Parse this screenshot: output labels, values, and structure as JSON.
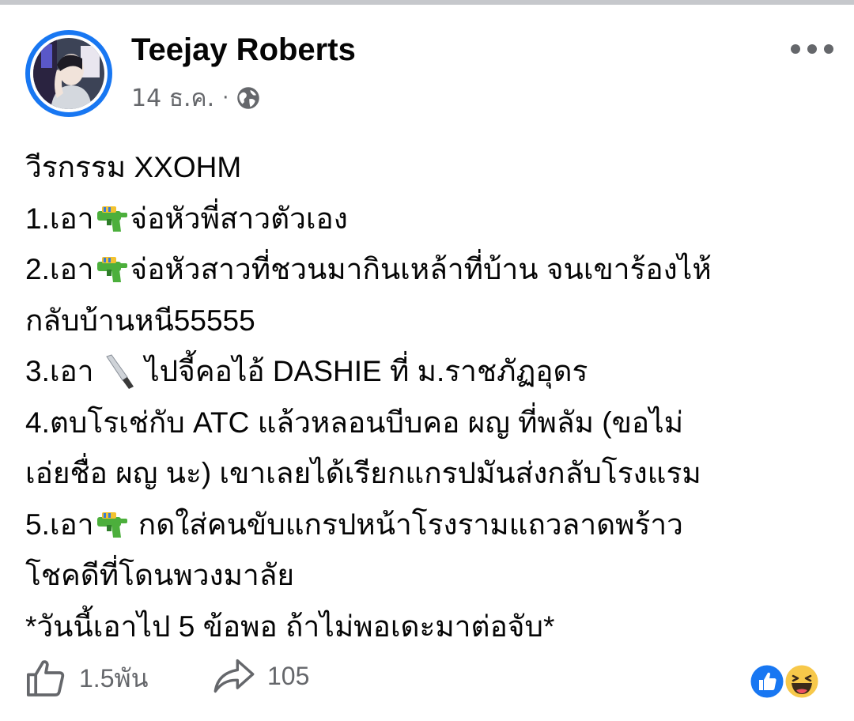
{
  "post": {
    "author": "Teejay Roberts",
    "date": "14 ธ.ค.",
    "separator": "·",
    "audience_icon": "globe-icon",
    "menu_icon": "more-horizontal-icon",
    "lines": [
      {
        "segments": [
          "วีรกรรม XXOHM"
        ]
      },
      {
        "segments": [
          "1.เอา",
          "จ่อหัวพี่สาวตัวเอง"
        ],
        "emoji": "water-pistol-emoji"
      },
      {
        "segments": [
          "2.เอา",
          "จ่อหัวสาวที่ชวนมากินเหล้าที่บ้าน จนเขาร้องไห้"
        ],
        "emoji": "water-pistol-emoji"
      },
      {
        "segments": [
          "กลับบ้านหนี55555"
        ]
      },
      {
        "segments": [
          "3.เอา ",
          " ไปจี้คอไอ้ DASHIE ที่ ม.ราชภัฏอุดร"
        ],
        "emoji": "knife-emoji"
      },
      {
        "segments": [
          "4.ตบโรเช่กับ ATC แล้วหลอนบีบคอ ผญ ที่พลัม (ขอไม่"
        ]
      },
      {
        "segments": [
          "เอ่ยชื่อ ผญ นะ) เขาเลยได้เรียกแกรปมันส่งกลับโรงแรม"
        ]
      },
      {
        "segments": [
          "5.เอา",
          " กดใส่คนขับแกรปหน้าโรงรามแถวลาดพร้าว"
        ],
        "emoji": "water-pistol-emoji"
      },
      {
        "segments": [
          "โชคดีที่โดนพวงมาลัย"
        ]
      },
      {
        "segments": [
          "*วันนี้เอาไป 5 ข้อพอ ถ้าไม่พอเดะมาต่อจับ*"
        ]
      }
    ]
  },
  "footer": {
    "like_icon": "thumbs-up-outline-icon",
    "like_count": "1.5พัน",
    "share_icon": "share-arrow-icon",
    "share_count": "105",
    "reaction_icons": [
      "like-reaction-icon",
      "haha-reaction-icon"
    ]
  },
  "colors": {
    "accent": "#1877f2",
    "muted_text": "#65676b",
    "body_text": "#050505"
  }
}
